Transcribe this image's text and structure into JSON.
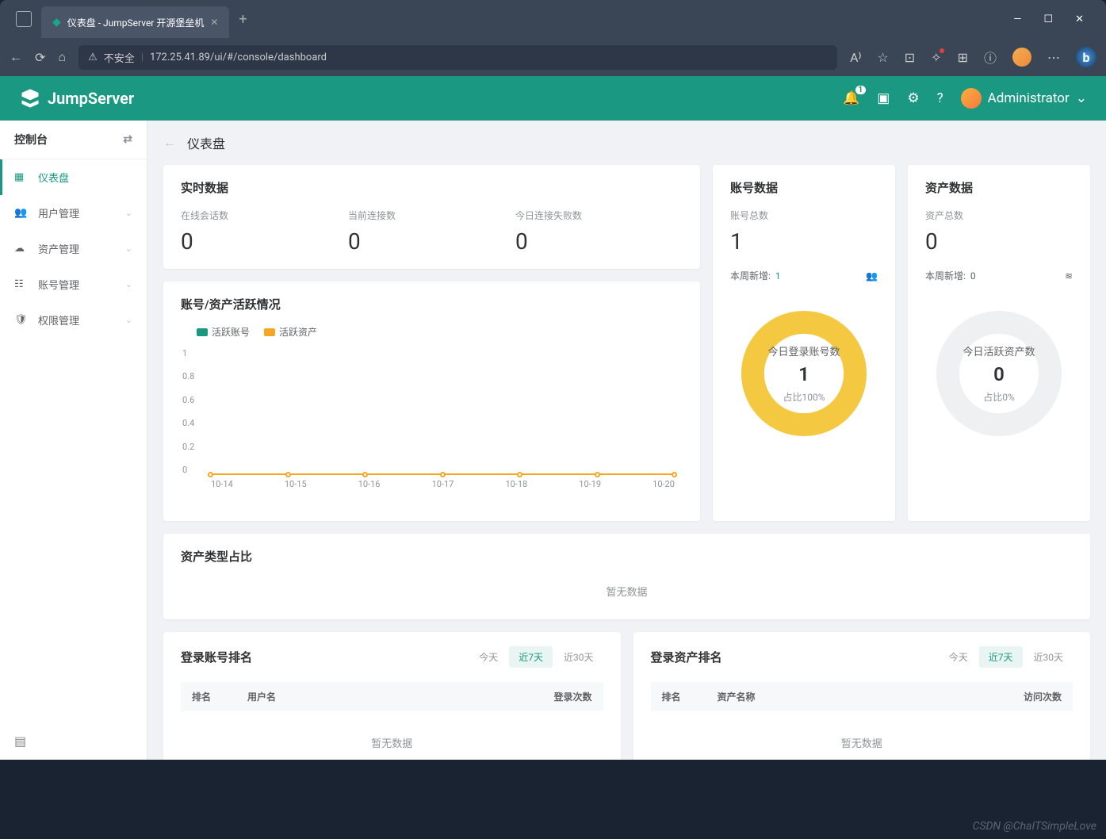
{
  "browser": {
    "tab_title": "仪表盘 - JumpServer 开源堡垒机",
    "new_tab": "+",
    "win": {
      "min": "—",
      "max": "☐",
      "close": "✕"
    },
    "nav": {
      "back": "←",
      "forward": "→",
      "refresh": "⟳",
      "home": "⌂"
    },
    "insecure": "不安全",
    "url": "172.25.41.89/ui/#/console/dashboard",
    "bing": "b"
  },
  "header": {
    "logo": "JumpServer",
    "notif_count": "1",
    "user": "Administrator"
  },
  "sidebar": {
    "title": "控制台",
    "items": [
      {
        "icon": "dashboard",
        "label": "仪表盘",
        "active": true
      },
      {
        "icon": "users",
        "label": "用户管理",
        "chev": true
      },
      {
        "icon": "assets",
        "label": "资产管理",
        "chev": true
      },
      {
        "icon": "accounts",
        "label": "账号管理",
        "chev": true
      },
      {
        "icon": "perms",
        "label": "权限管理",
        "chev": true
      }
    ]
  },
  "page": {
    "title": "仪表盘",
    "realtime": {
      "title": "实时数据",
      "stats": [
        {
          "label": "在线会话数",
          "value": "0"
        },
        {
          "label": "当前连接数",
          "value": "0"
        },
        {
          "label": "今日连接失败数",
          "value": "0"
        }
      ]
    },
    "accounts": {
      "title": "账号数据",
      "total_label": "账号总数",
      "total": "1",
      "new_label": "本周新增:",
      "new_value": "1",
      "donut_label": "今日登录账号数",
      "donut_value": "1",
      "donut_pct": "占比100%"
    },
    "assets": {
      "title": "资产数据",
      "total_label": "资产总数",
      "total": "0",
      "new_label": "本周新增:",
      "new_value": "0",
      "donut_label": "今日活跃资产数",
      "donut_value": "0",
      "donut_pct": "占比0%"
    },
    "activity": {
      "title": "账号/资产活跃情况",
      "legend": [
        {
          "color": "#1a9881",
          "label": "活跃账号"
        },
        {
          "color": "#f5a623",
          "label": "活跃资产"
        }
      ]
    },
    "asset_type": {
      "title": "资产类型占比",
      "nodata": "暂无数据"
    },
    "rank_tabs": [
      "今天",
      "近7天",
      "近30天"
    ],
    "rank_login": {
      "title": "登录账号排名",
      "cols": [
        "排名",
        "用户名",
        "登录次数"
      ],
      "nodata": "暂无数据"
    },
    "rank_asset": {
      "title": "登录资产排名",
      "cols": [
        "排名",
        "资产名称",
        "访问次数"
      ],
      "nodata": "暂无数据"
    }
  },
  "chart_data": {
    "type": "line",
    "title": "账号/资产活跃情况",
    "categories": [
      "10-14",
      "10-15",
      "10-16",
      "10-17",
      "10-18",
      "10-19",
      "10-20"
    ],
    "series": [
      {
        "name": "活跃账号",
        "values": [
          0,
          0,
          0,
          0,
          0,
          0,
          0
        ]
      },
      {
        "name": "活跃资产",
        "values": [
          0,
          0,
          0,
          0,
          0,
          0,
          0
        ]
      }
    ],
    "ylim": [
      0,
      1
    ],
    "yticks": [
      0,
      0.2,
      0.4,
      0.6,
      0.8,
      1
    ]
  },
  "watermark": "CSDN @ChaITSimpleLove"
}
